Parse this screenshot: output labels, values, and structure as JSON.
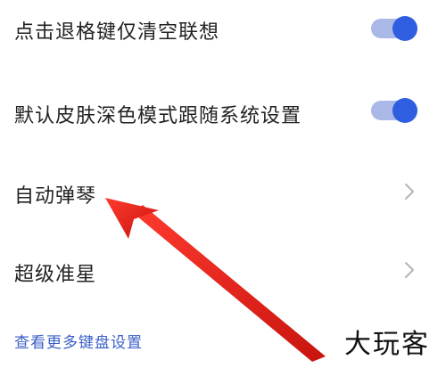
{
  "settings": {
    "rows": [
      {
        "label": "点击退格键仅清空联想",
        "control": "toggle",
        "on": true
      },
      {
        "label": "默认皮肤深色模式跟随系统设置",
        "control": "toggle",
        "on": true
      },
      {
        "label": "自动弹琴",
        "control": "chevron"
      },
      {
        "label": "超级准星",
        "control": "chevron"
      }
    ],
    "more_link": "查看更多键盘设置"
  },
  "watermark": "大玩客",
  "colors": {
    "toggle_knob": "#2f5fe0",
    "toggle_track": "#a9b8e6",
    "link": "#3a5fc8",
    "arrow": "#e0201a"
  },
  "icons": {
    "chevron": "chevron-right-icon",
    "annotation": "red-arrow"
  }
}
